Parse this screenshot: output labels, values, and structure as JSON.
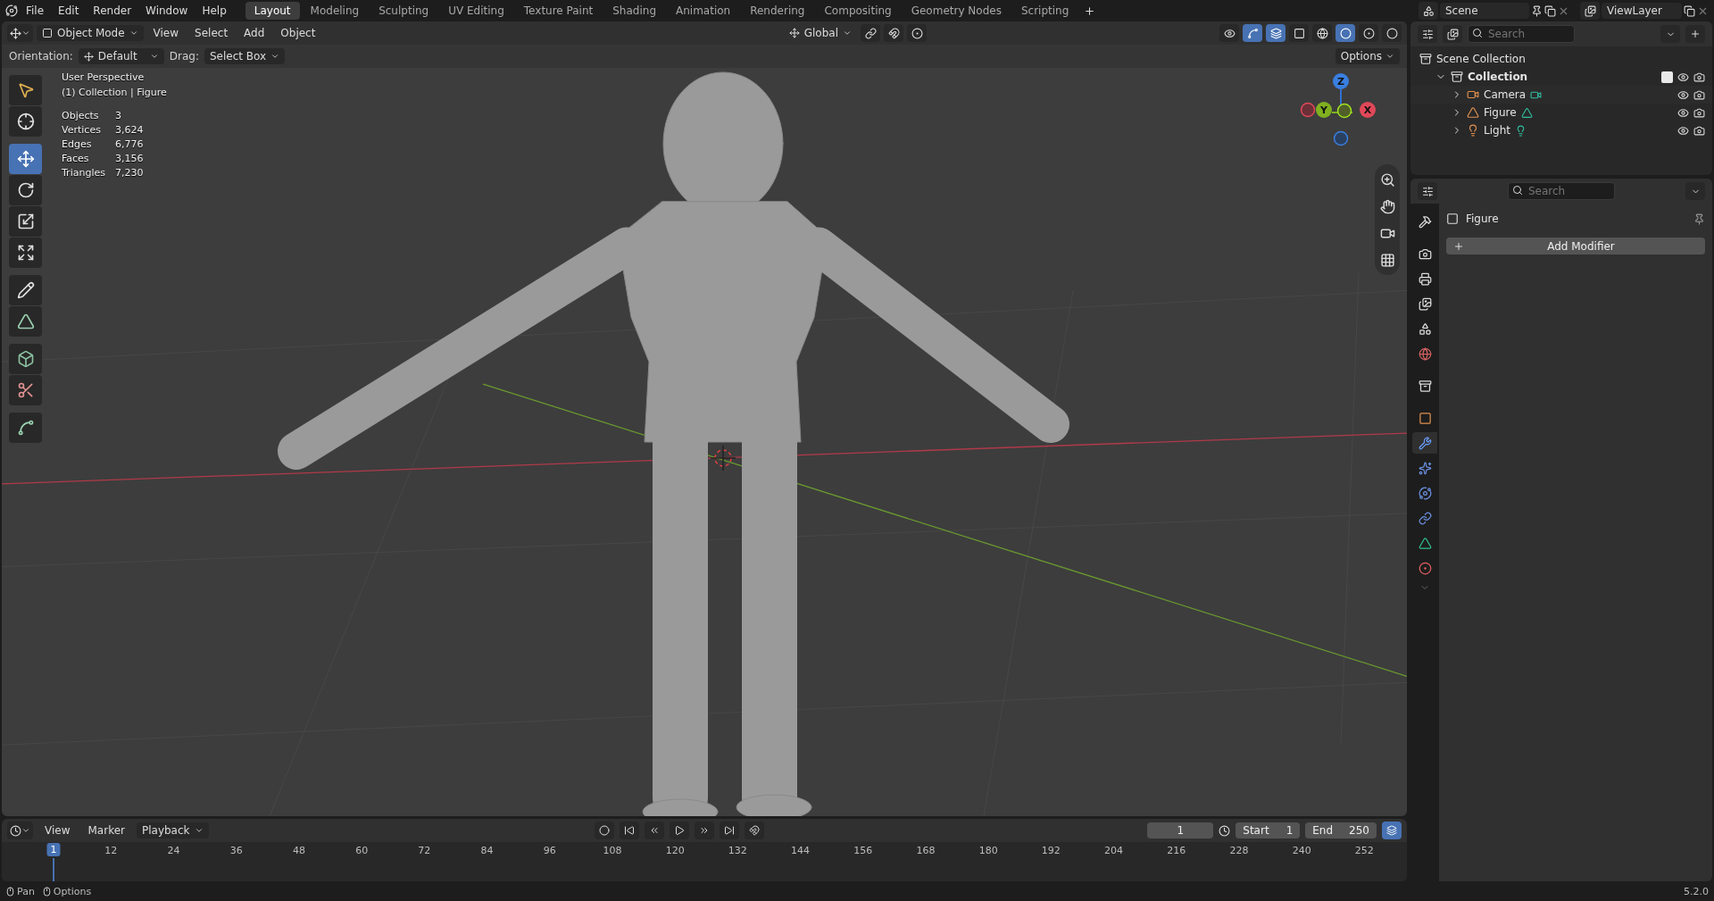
{
  "top_bar": {
    "menus": [
      "File",
      "Edit",
      "Render",
      "Window",
      "Help"
    ],
    "workspaces": [
      {
        "label": "Layout",
        "selected": true
      },
      {
        "label": "Modeling",
        "selected": false
      },
      {
        "label": "Sculpting",
        "selected": false
      },
      {
        "label": "UV Editing",
        "selected": false
      },
      {
        "label": "Texture Paint",
        "selected": false
      },
      {
        "label": "Shading",
        "selected": false
      },
      {
        "label": "Animation",
        "selected": false
      },
      {
        "label": "Rendering",
        "selected": false
      },
      {
        "label": "Compositing",
        "selected": false
      },
      {
        "label": "Geometry Nodes",
        "selected": false
      },
      {
        "label": "Scripting",
        "selected": false
      }
    ],
    "scene": "Scene",
    "view_layer": "ViewLayer"
  },
  "viewport": {
    "header": {
      "mode": "Object Mode",
      "menus": [
        "View",
        "Select",
        "Add",
        "Object"
      ],
      "orientation": "Global"
    },
    "tool_settings": {
      "orientation_label": "Orientation:",
      "orientation": "Default",
      "drag_label": "Drag:",
      "drag": "Select Box",
      "options": "Options"
    },
    "tools": [
      {
        "selected": false
      },
      {
        "selected": false
      },
      {
        "selected": true
      },
      {
        "selected": false
      },
      {
        "selected": false
      },
      {
        "selected": false
      },
      {
        "selected": false
      },
      {
        "selected": false
      },
      {
        "selected": false
      },
      {
        "selected": false
      },
      {
        "selected": false
      }
    ],
    "overlay": {
      "title": "User Perspective",
      "subtitle": "(1) Collection | Figure",
      "stats": [
        {
          "label": "Objects",
          "value": "3"
        },
        {
          "label": "Vertices",
          "value": "3,624"
        },
        {
          "label": "Edges",
          "value": "6,776"
        },
        {
          "label": "Faces",
          "value": "3,156"
        },
        {
          "label": "Triangles",
          "value": "7,230"
        }
      ]
    },
    "gizmo": {
      "x": "X",
      "y": "Y",
      "z": "Z"
    }
  },
  "timeline": {
    "menus": [
      "View",
      "Marker",
      "Playback"
    ],
    "current_frame": "1",
    "start_label": "Start",
    "start": "1",
    "end_label": "End",
    "end": "250",
    "playhead": "1",
    "ticks": [
      "12",
      "24",
      "36",
      "48",
      "60",
      "72",
      "84",
      "96",
      "108",
      "120",
      "132",
      "144",
      "156",
      "168",
      "180",
      "192",
      "204",
      "216",
      "228",
      "240",
      "252"
    ]
  },
  "status_bar": {
    "items": [
      "Pan",
      "Options"
    ],
    "version": "5.2.0"
  },
  "outliner": {
    "search_placeholder": "Search",
    "root": {
      "label": "Scene Collection",
      "children": [
        {
          "label": "Collection",
          "expanded": true,
          "checked": true,
          "children": [
            {
              "label": "Camera",
              "kind": "camera",
              "expanded": false
            },
            {
              "label": "Figure",
              "kind": "mesh",
              "expanded": false
            },
            {
              "label": "Light",
              "kind": "light",
              "expanded": false
            }
          ]
        }
      ]
    }
  },
  "properties": {
    "search_placeholder": "Search",
    "object_name": "Figure",
    "add_modifier": "Add Modifier",
    "tabs": [
      {
        "selected": false
      },
      {
        "selected": false
      },
      {
        "selected": false
      },
      {
        "selected": false
      },
      {
        "selected": false
      },
      {
        "selected": false
      },
      {
        "selected": false
      },
      {
        "selected": false
      },
      {
        "selected": true
      },
      {
        "selected": false
      },
      {
        "selected": false
      },
      {
        "selected": false
      },
      {
        "selected": false
      },
      {
        "selected": false
      }
    ]
  }
}
